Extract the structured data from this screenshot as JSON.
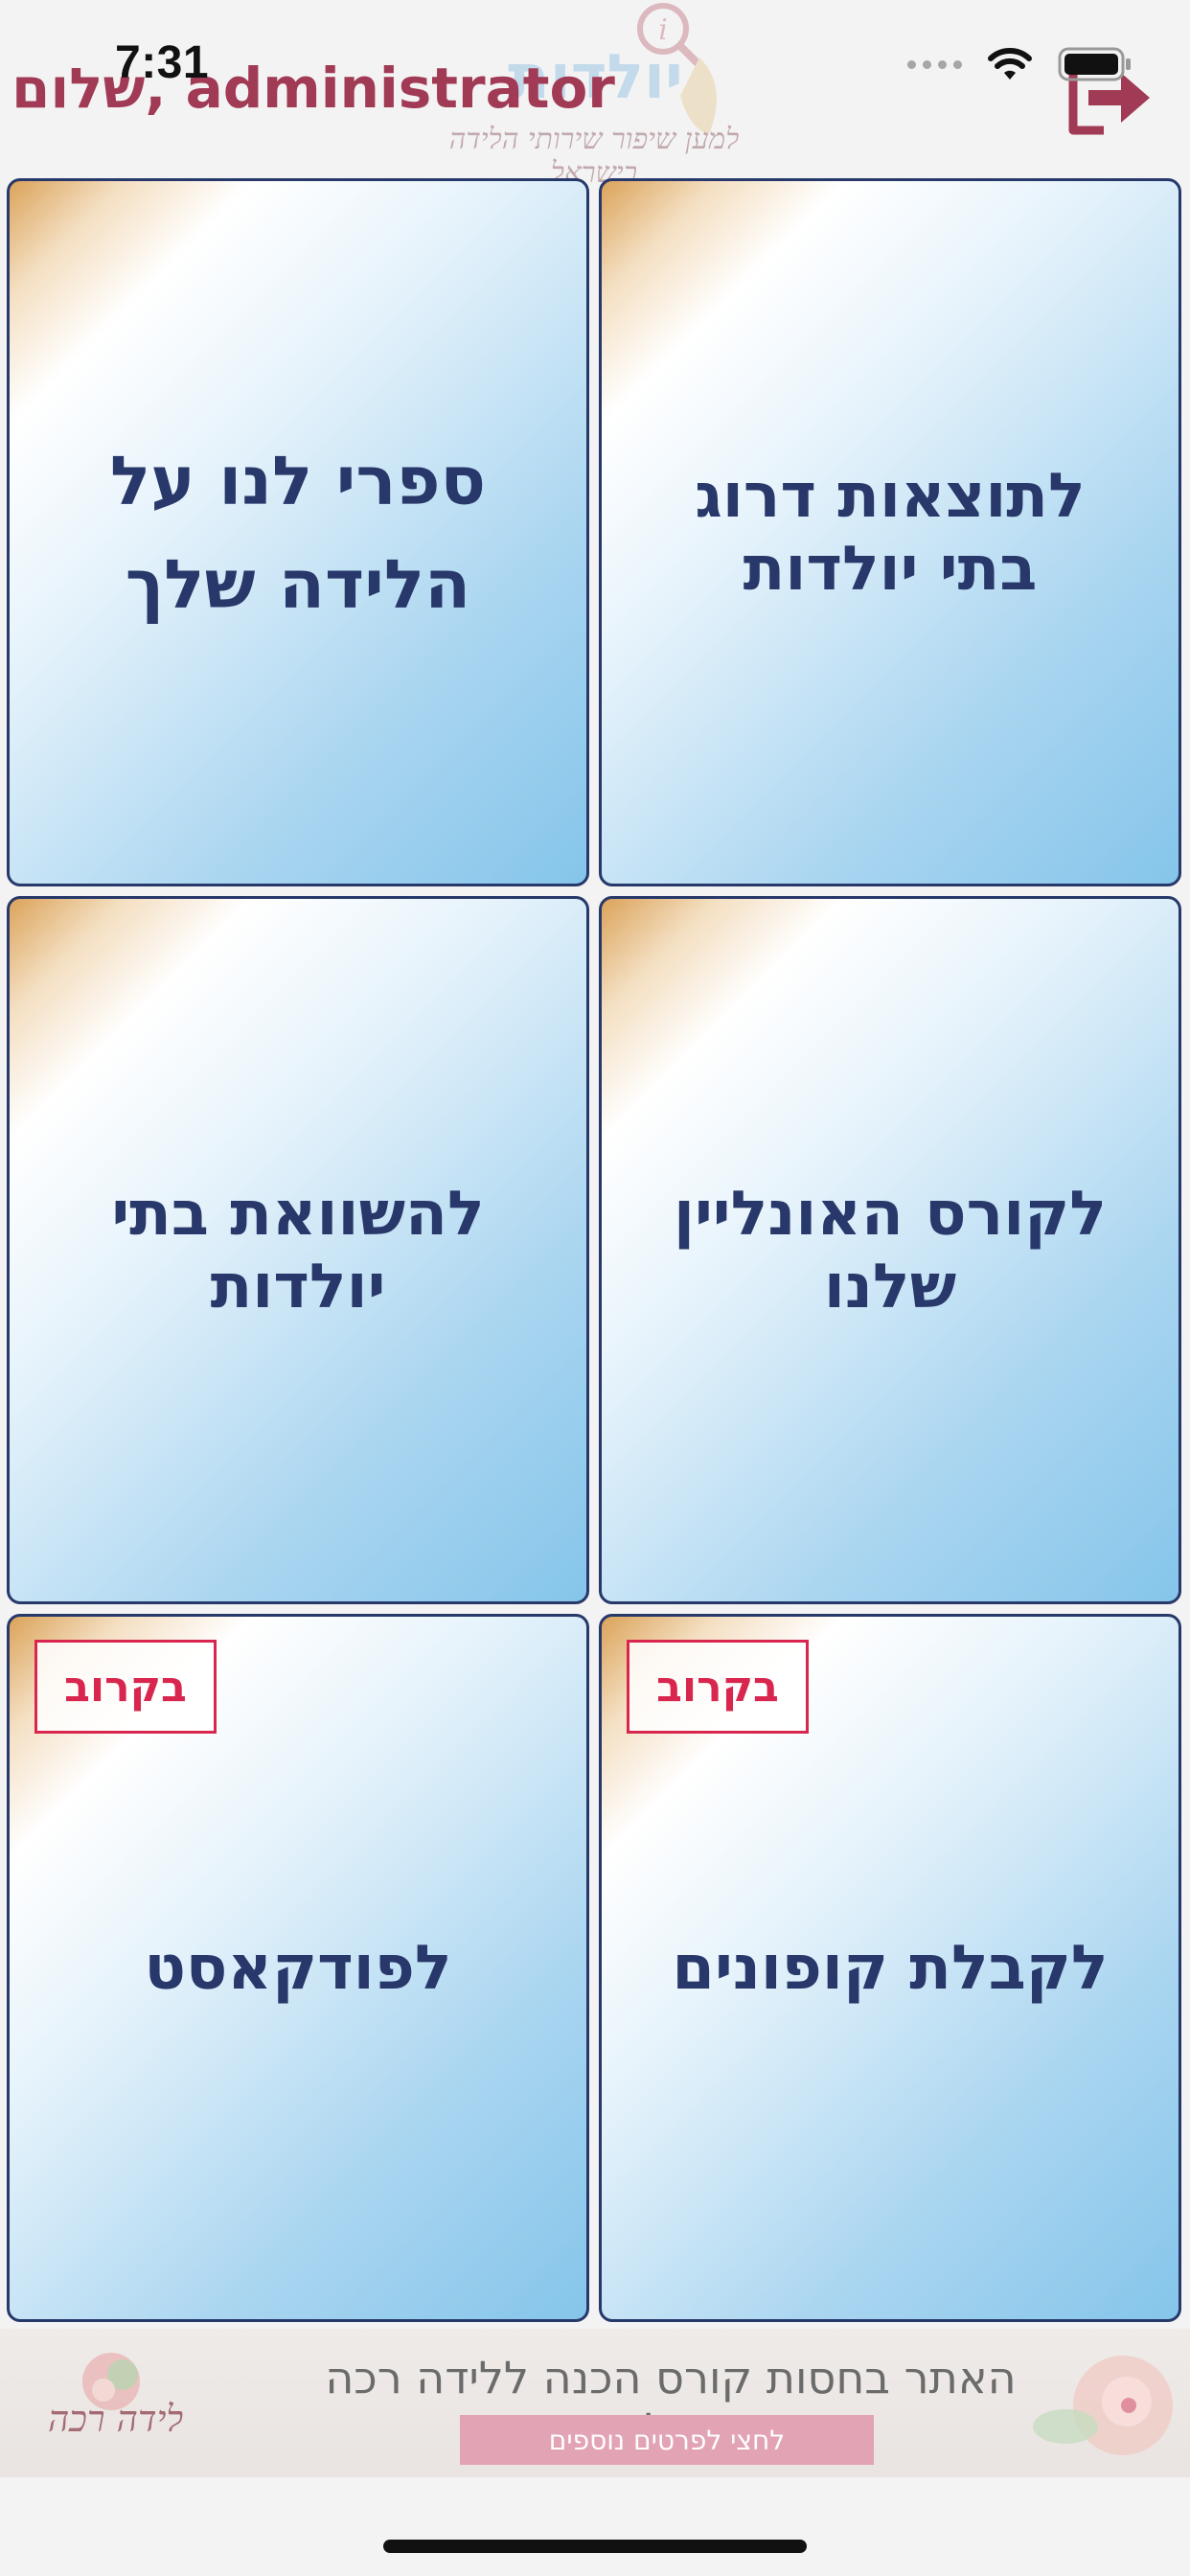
{
  "status_bar": {
    "time": "7:31"
  },
  "header": {
    "greeting": "שלום, administrator",
    "logo_text": "יולדות",
    "logo_tagline": "למען שיפור שירותי הלידה בישראל"
  },
  "tiles": [
    {
      "label": "לתוצאות דרוג בתי יולדות",
      "badge": ""
    },
    {
      "label": "ספרי לנו על הלידה שלך",
      "badge": ""
    },
    {
      "label": "לקורס האונליין שלנו",
      "badge": ""
    },
    {
      "label": "להשוואת בתי יולדות",
      "badge": ""
    },
    {
      "label": "לקבלת קופונים",
      "badge": "בקרוב"
    },
    {
      "label": "לפודקאסט",
      "badge": "בקרוב"
    }
  ],
  "banner": {
    "headline": "האתר בחסות קורס הכנה ללידה רכה אונליין",
    "button_label": "לחצי לפרטים נוספים",
    "logo_text": "לידה רכה"
  },
  "colors": {
    "accent": "#a13a55",
    "tile_text": "#28386a",
    "tile_border": "#27386a",
    "badge": "#d8264e"
  }
}
